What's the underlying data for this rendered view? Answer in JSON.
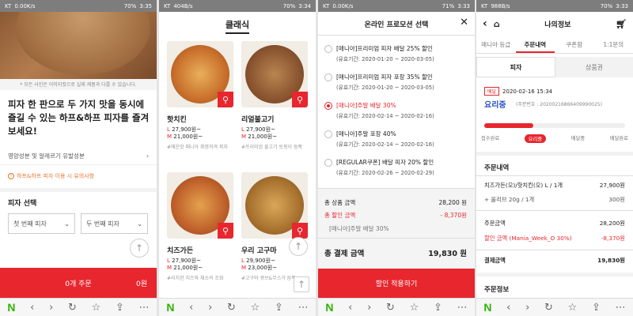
{
  "panel1": {
    "status": {
      "carrier": "KT",
      "speed": "0.00K/s",
      "battery": "70%",
      "time": "3:35"
    },
    "disclaimer": "* 모든 사진은 이미지컷으로 실제 제품과 다를 수 있습니다.",
    "headline": "피자 한 판으로 두 가지 맛을 동시에 즐길 수 있는 하프&하프 피자를 즐겨보세요!",
    "nutrition_link": "영양성분 및 알레르기 유발성분",
    "notice": "하프&하프 피자 이용 시 유의사항",
    "section_title": "피자 선택",
    "select_first": "첫 번째 피자",
    "select_second": "두 번째 피자",
    "order_label": "0개 주문",
    "order_price": "0원"
  },
  "panel2": {
    "status": {
      "carrier": "KT",
      "speed": "404B/s",
      "battery": "70%",
      "time": "3:34"
    },
    "title": "클래식",
    "items": [
      {
        "name": "핫치킨",
        "l_price": "27,900원~",
        "m_price": "21,000원~",
        "l_old": "",
        "m_old": "",
        "tag": "#매운맛 매니아 취향저격 피자"
      },
      {
        "name": "리얼불고기",
        "l_price": "27,900원~",
        "m_price": "21,000원~",
        "l_old": "",
        "m_old": "",
        "tag": "#프리미엄 불고기 토핑이 듬뿍"
      },
      {
        "name": "치즈가든",
        "l_price": "27,900원~",
        "m_price": "21,000원~",
        "l_old": "",
        "m_old": "",
        "tag": "#리치한 치즈와 채소의 조화"
      },
      {
        "name": "우리 고구마",
        "l_price": "29,900원~",
        "m_price": "23,000원~",
        "l_old": "",
        "m_old": "",
        "tag": "#고구마 큐브&무스가 듬뿍"
      }
    ]
  },
  "panel3": {
    "status": {
      "carrier": "KT",
      "speed": "0.00K/s",
      "battery": "71%",
      "time": "3:33"
    },
    "title": "온라인 프로모션 선택",
    "promos": [
      {
        "title": "[매니아]프리미엄 피자 배달 25% 할인",
        "period": "(유효기간: 2020-01-20 ~ 2020-03-05)",
        "selected": false
      },
      {
        "title": "[매니아]프리미엄 피자 포장 35% 할인",
        "period": "(유효기간: 2020-01-20 ~ 2020-03-05)",
        "selected": false
      },
      {
        "title": "[매니아]주말 배달 30%",
        "period": "(유효기간: 2020-02-14 ~ 2020-02-16)",
        "selected": true
      },
      {
        "title": "[매니아]주말 포장 40%",
        "period": "(유효기간: 2020-02-14 ~ 2020-02-16)",
        "selected": false
      },
      {
        "title": "[REGULAR쿠폰] 배달 피자 20% 할인",
        "period": "(유효기간: 2020-02-26 ~ 2020-02-29)",
        "selected": false
      }
    ],
    "total_label": "총 상품 금액",
    "total_value": "28,200 원",
    "discount_label": "총 할인 금액",
    "discount_value": "- 8,370원",
    "discount_note": "[매니아]주말 배달 30%",
    "pay_label": "총 결제 금액",
    "pay_value": "19,830 원",
    "apply_label": "할인 적용하기"
  },
  "panel4": {
    "status": {
      "carrier": "KT",
      "speed": "988B/s",
      "battery": "70%",
      "time": "3:33"
    },
    "title": "나의정보",
    "tabs": [
      "매니아 등급",
      "주문내역",
      "쿠폰함",
      "1:1문의"
    ],
    "subtabs": [
      "피자",
      "상품권"
    ],
    "badge": "배달",
    "datetime": "2020-02-16 15:34",
    "status_text": "요리중",
    "order_no": "(주문번호 : 20200216866409990025)",
    "progress_fraction": 0.35,
    "steps": [
      "접수완료",
      "요리중",
      "배달중",
      "배달완료"
    ],
    "section_order": "주문내역",
    "item_line": "치즈가든(오)/핫치킨(오) L / 1개",
    "item_price": "27,900원",
    "topping_line": "+ 올리브 20g / 1개",
    "topping_price": "300원",
    "amount_label": "주문금액",
    "amount_value": "28,200원",
    "discount_label": "할인 금액 (Mania_Week_O 30%)",
    "discount_value": "-8,370원",
    "pay_label": "결제금액",
    "pay_value": "19,830원",
    "section_info": "주문정보"
  },
  "colors": {
    "accent": "#e8262d",
    "naver": "#2db400"
  }
}
